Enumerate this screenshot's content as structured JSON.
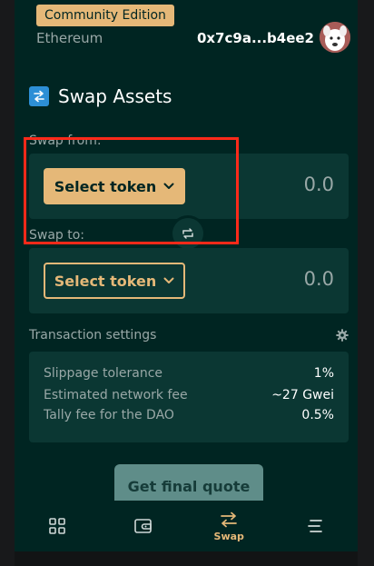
{
  "header": {
    "edition_badge": "Community Edition",
    "network": "Ethereum",
    "account_address": "0x7c9a...b4ee2"
  },
  "swap": {
    "title": "Swap Assets",
    "from_label": "Swap from:",
    "to_label": "Swap to:",
    "from": {
      "button_label": "Select token",
      "amount": "0.0"
    },
    "to": {
      "button_label": "Select token",
      "amount": "0.0"
    }
  },
  "transaction_settings": {
    "label": "Transaction settings",
    "rows": [
      {
        "label": "Slippage tolerance",
        "value": "1%"
      },
      {
        "label": "Estimated network fee",
        "value": "~27 Gwei"
      },
      {
        "label": "Tally fee for the DAO",
        "value": "0.5%"
      }
    ]
  },
  "actions": {
    "quote_button": "Get final quote"
  },
  "bottom_nav": {
    "items": [
      {
        "icon": "grid-icon",
        "label": ""
      },
      {
        "icon": "wallet-icon",
        "label": ""
      },
      {
        "icon": "swap-icon",
        "label": "Swap",
        "active": true
      },
      {
        "icon": "menu-icon",
        "label": ""
      }
    ]
  },
  "colors": {
    "background": "#002522",
    "accent": "#e5b878",
    "card": "#0b3733",
    "muted_text": "#99a8a7",
    "annotation": "#ff2a1a"
  }
}
